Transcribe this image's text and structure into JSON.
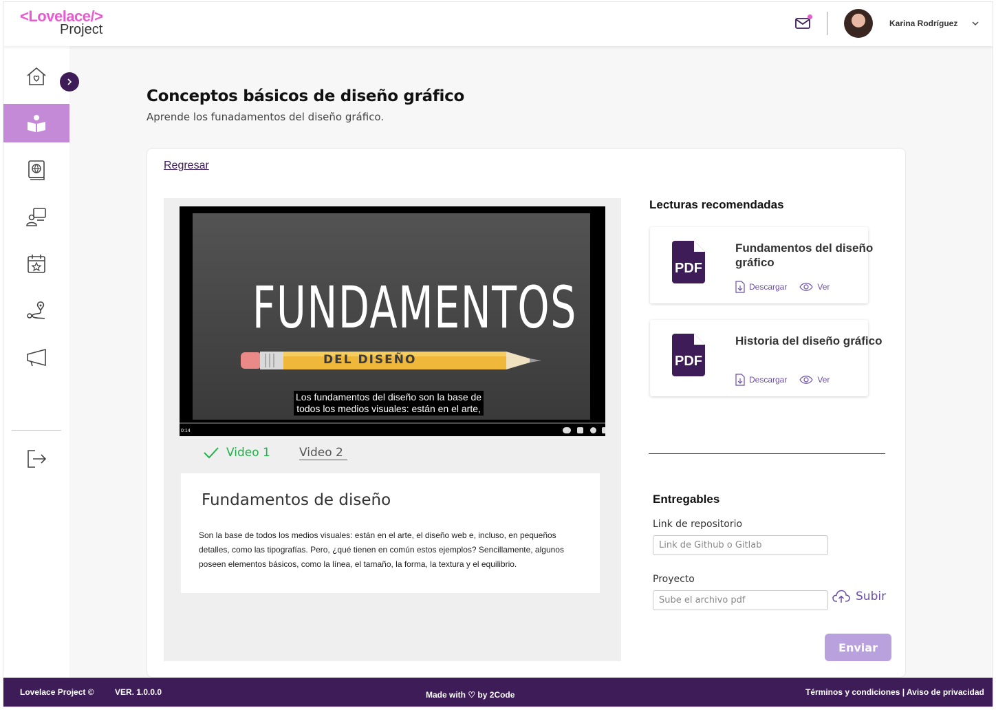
{
  "header": {
    "logo_top": "<Lovelace/>",
    "logo_bottom": "Project",
    "user_name": "Karina Rodríguez",
    "icons": [
      "mail-icon",
      "chevron-down-icon"
    ]
  },
  "sidebar": {
    "items": [
      {
        "name": "home",
        "icon": "home-heart-icon",
        "active": false
      },
      {
        "name": "learning",
        "icon": "book-reader-icon",
        "active": true
      },
      {
        "name": "resources",
        "icon": "globe-book-icon",
        "active": false
      },
      {
        "name": "mentoring",
        "icon": "user-screen-icon",
        "active": false
      },
      {
        "name": "events",
        "icon": "calendar-star-icon",
        "active": false
      },
      {
        "name": "roadmap",
        "icon": "route-pin-icon",
        "active": false
      },
      {
        "name": "announcements",
        "icon": "megaphone-icon",
        "active": false
      }
    ],
    "logout_icon": "logout-icon",
    "accent_color": "#c48ad8"
  },
  "page": {
    "title": "Conceptos básicos de diseño gráfico",
    "subtitle": "Aprende los funadamentos del diseño gráfico."
  },
  "content": {
    "back_label": "Regresar",
    "video": {
      "title_text": "FUNDAMENTOS",
      "pencil_text": "DEL DISEÑO",
      "caption_line1": "Los fundamentos del diseño son la base de",
      "caption_line2": "todos los medios visuales: están en el arte,",
      "time": "0:14"
    },
    "tabs": [
      {
        "label": "Video 1",
        "completed": true
      },
      {
        "label": "Video 2",
        "completed": false
      }
    ],
    "description": {
      "title": "Fundamentos de diseño",
      "text": "Son la base de todos los medios visuales: están en el arte, el diseño web e, incluso, en pequeños detalles, como las tipografías. Pero, ¿qué tienen en común estos ejemplos? Sencillamente, algunos poseen elementos básicos, como la línea, el tamaño, la forma, la textura y el equilibrio."
    }
  },
  "readings": {
    "title": "Lecturas recomendadas",
    "items": [
      {
        "title": "Fundamentos del diseño gráfico",
        "download_label": "Descargar",
        "view_label": "Ver",
        "icon": "pdf-icon"
      },
      {
        "title": "Historia del diseño gráfico",
        "download_label": "Descargar",
        "view_label": "Ver",
        "icon": "pdf-icon"
      }
    ]
  },
  "deliverables": {
    "title": "Entregables",
    "repo_label": "Link de repositorio",
    "repo_placeholder": "Link de Github o Gitlab",
    "project_label": "Proyecto",
    "project_placeholder": "Sube el archivo pdf",
    "upload_label": "Subir",
    "submit_label": "Enviar"
  },
  "footer": {
    "brand": "Lovelace Project ©",
    "version": "VER. 1.0.0.0",
    "made_with": "Made with ♡ by 2Code",
    "legal": "Términos y condiciones | Aviso de privacidad"
  },
  "colors": {
    "brand_dark": "#3d1c57",
    "brand_pink": "#e85ccf",
    "link_purple": "#6b4ea8",
    "success_green": "#22b04a",
    "button_disabled": "#b9a1de"
  }
}
